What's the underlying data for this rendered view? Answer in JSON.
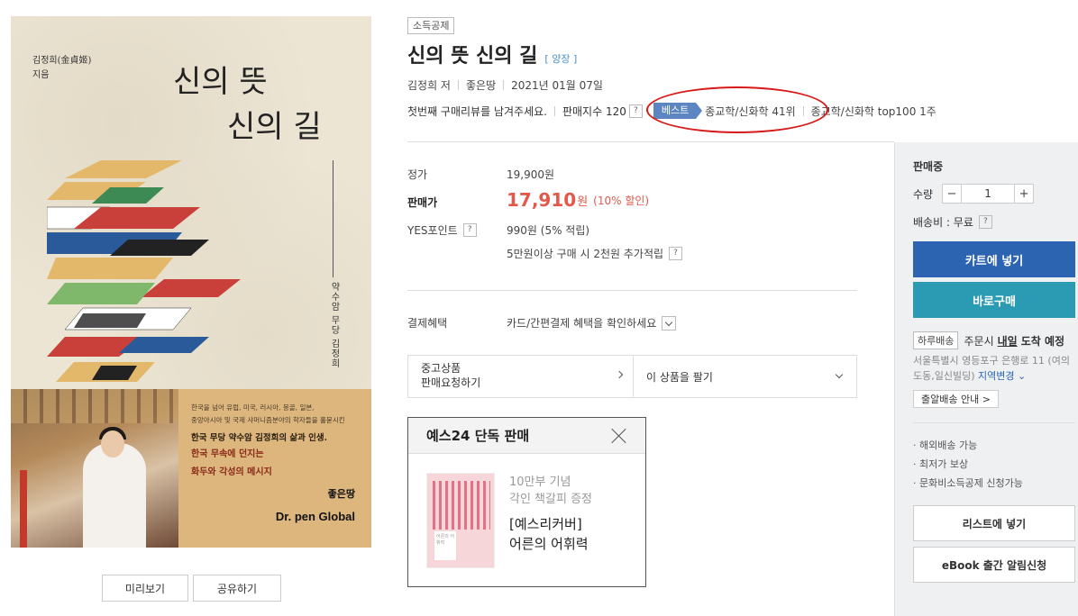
{
  "cover": {
    "author_line": "김정희(金貞姬)",
    "author_role": "지음",
    "title_line1": "신의 뜻",
    "title_line2": "신의 길",
    "vertical_text": "약수암 무당 김정희",
    "blurb_lines": [
      "한국을 넘어 유럽, 미국, 러시아, 몽골, 일본,",
      "중앙아시아 및 국제 샤머니즘분야의 학자들을 홀묻시킨"
    ],
    "blurb_highlight": "한국 무당 약수암 김정희의 삶과 인생.",
    "blurb_red_1": "한국 무속에 던지는",
    "blurb_red_2": "화두와 각성의 메시지",
    "publisher_logo": "좋은땅",
    "publisher_en": "Dr. pen Global",
    "preview_label": "미리보기",
    "share_label": "공유하기"
  },
  "product": {
    "tag": "소득공제",
    "title": "신의 뜻 신의 길",
    "binding": "[ 양장 ]",
    "author": "김정희 저",
    "publisher": "좋은땅",
    "pub_date": "2021년 01월 07일",
    "review_prompt": "첫번째 구매리뷰를 남겨주세요.",
    "sales_index": "판매지수 120",
    "best_badge": "베스트",
    "best_rank": "종교학/신화학 41위",
    "top100": "종교학/신화학 top100 1주"
  },
  "pricing": {
    "list_price_label": "정가",
    "list_price": "19,900원",
    "sale_label": "판매가",
    "sale_price": "17,910",
    "sale_unit": "원",
    "discount": "(10% 할인)",
    "points_label": "YES포인트",
    "points": "990원 (5% 적립)",
    "extra_points": "5만원이상 구매 시 2천원 추가적립",
    "payment_label": "결제혜택",
    "payment_text": "카드/간편결제 혜택을 확인하세요"
  },
  "used": {
    "left_line1": "중고상품",
    "left_line2": "판매요청하기",
    "right_label": "이 상품을 팔기"
  },
  "exclusive": {
    "title": "예스24 단독 판매",
    "sub1": "10만부 기념",
    "sub2": "각인 책갈피 증정",
    "main1": "[예스리커버]",
    "main2": "어른의 어휘력",
    "book_label": "어른의 어휘력"
  },
  "buybox": {
    "status": "판매중",
    "qty_label": "수량",
    "qty_minus": "−",
    "qty_value": "1",
    "qty_plus": "+",
    "shipping": "배송비 : 무료",
    "cart_button": "카트에 넣기",
    "buy_button": "바로구매",
    "day_tag": "하루배송",
    "day_text": "주문시",
    "day_bold": "내일",
    "day_bold2": "도착 예정",
    "address": "서울특별시 영등포구 은행로 11 (여의도동,일신빌딩)",
    "address_link": "지역변경",
    "today_button": "출알배송 안내 >",
    "features": [
      "해외배송 가능",
      "최저가 보상",
      "문화비소득공제 신청가능"
    ],
    "wishlist_button": "리스트에 넣기",
    "ebook_button": "eBook 출간 알림신청"
  },
  "colors": {
    "price_red": "#e2584a",
    "cart_blue": "#2c64b2",
    "buy_teal": "#2b9bb4",
    "best_blue": "#5b86c1",
    "annotation_red": "#d61a1a"
  }
}
